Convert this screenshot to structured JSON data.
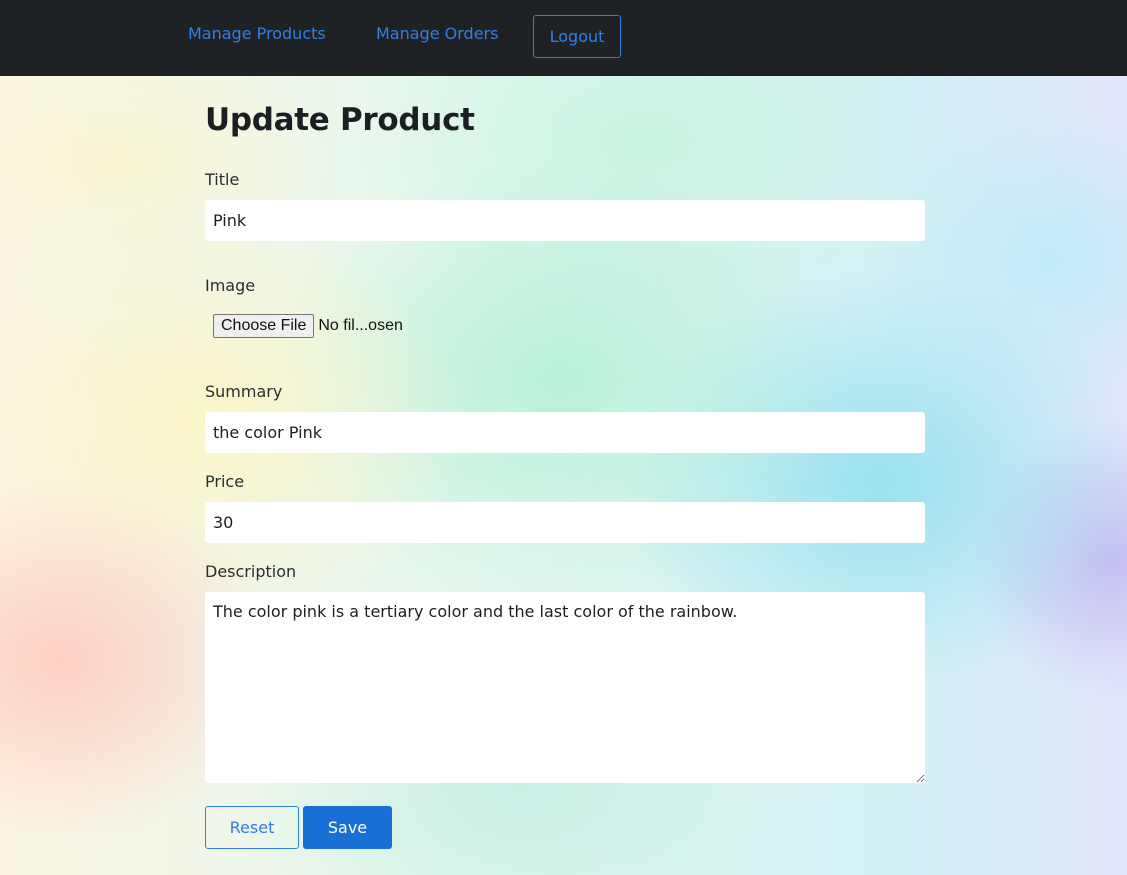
{
  "nav": {
    "manage_products": "Manage Products",
    "manage_orders": "Manage Orders",
    "logout": "Logout"
  },
  "page": {
    "title": "Update Product"
  },
  "form": {
    "title_label": "Title",
    "title_value": "Pink",
    "image_label": "Image",
    "choose_file_label": "Choose File",
    "file_status": "No fil...osen",
    "summary_label": "Summary",
    "summary_value": "the color Pink",
    "price_label": "Price",
    "price_value": "30",
    "description_label": "Description",
    "description_value": "The color pink is a tertiary color and the last color of the rainbow.",
    "reset_label": "Reset",
    "save_label": "Save"
  },
  "colors": {
    "navbar_bg": "#1f2225",
    "link": "#2f7fe6",
    "primary": "#1a6fd6"
  }
}
